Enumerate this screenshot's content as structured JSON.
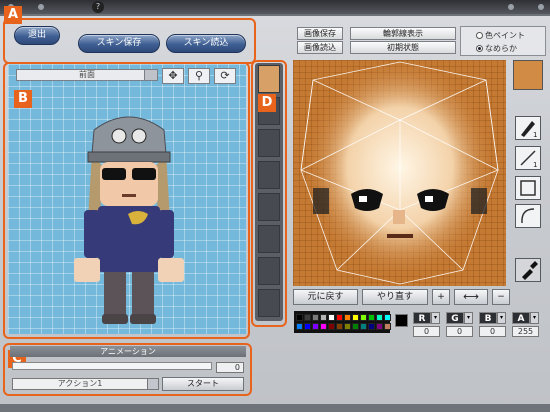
{
  "markers": {
    "a": "A",
    "b": "B",
    "c": "C",
    "d": "D"
  },
  "top": {
    "exit_label": "退出",
    "save_skin_label": "スキン保存",
    "load_skin_label": "スキン読込",
    "save_image_label": "画像保存",
    "load_image_label": "画像読込",
    "outline_label": "輪郭線表示",
    "reset_label": "初期状態",
    "paint_mode_label": "色ペイント",
    "smooth_mode_label": "なめらか",
    "smooth_selected": true
  },
  "preview": {
    "view_value": "前面",
    "move_icon": "move-arrows-icon",
    "zoom_icon": "magnifier-icon",
    "rotate_icon": "rotate-icon"
  },
  "parts_strip": {
    "slot_count": 8,
    "selected_icon": "character-face-icon"
  },
  "editor": {
    "undo_label": "元に戻す",
    "redo_label": "やり直す",
    "plus_label": "+",
    "minus_label": "−"
  },
  "tools": [
    "pen-icon",
    "line-icon",
    "rectangle-icon",
    "curve-icon",
    "eyedropper-icon"
  ],
  "pen_size": "1",
  "line_size": "1",
  "palette": {
    "colors": [
      "#000000",
      "#3b3b3b",
      "#7a7a7a",
      "#b5b5b5",
      "#ffffff",
      "#ff0000",
      "#ff8000",
      "#ffff00",
      "#80ff00",
      "#00c000",
      "#00ffc0",
      "#00ffff",
      "#0080ff",
      "#0000ff",
      "#8000ff",
      "#ff00ff",
      "#800000",
      "#804000",
      "#808000",
      "#008000",
      "#008080",
      "#000080",
      "#800080",
      "#c08060"
    ],
    "current": "#000000"
  },
  "rgb": {
    "r_label": "R",
    "g_label": "G",
    "b_label": "B",
    "a_label": "A",
    "r_value": "0",
    "g_value": "0",
    "b_value": "0",
    "a_value": "255"
  },
  "animation": {
    "title": "アニメーション",
    "frame_value": "0",
    "action_value": "アクション1",
    "start_label": "スタート"
  }
}
